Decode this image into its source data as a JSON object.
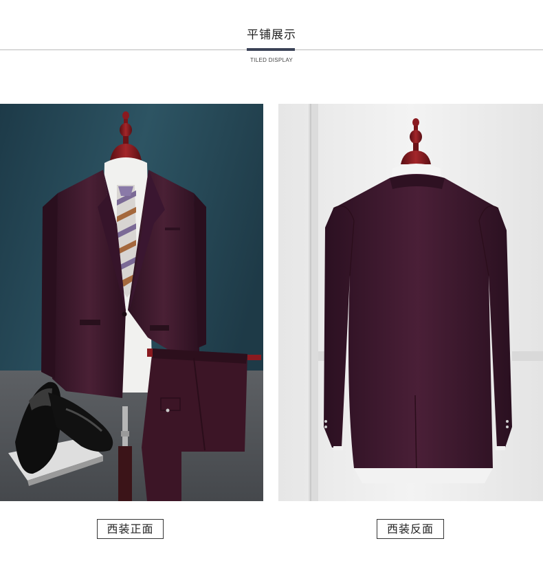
{
  "header": {
    "title": "平铺展示",
    "subtitle": "TILED DISPLAY"
  },
  "photos": {
    "front_caption": "西装正面",
    "back_caption": "西装反面"
  },
  "colors": {
    "accent": "#3b4257",
    "suit": "#3e1a2c",
    "front_background": "#274753",
    "back_background": "#ececec"
  }
}
